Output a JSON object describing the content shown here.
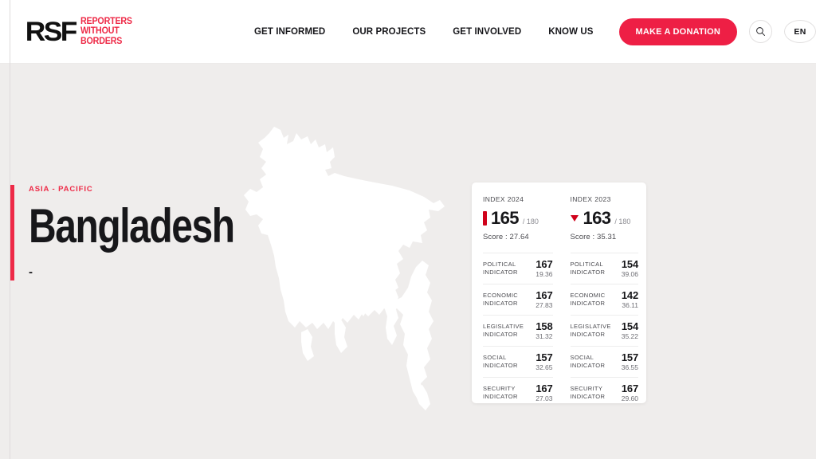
{
  "header": {
    "logo": {
      "mark": "RSF",
      "line1": "REPORTERS",
      "line2": "WITHOUT BORDERS"
    },
    "nav": [
      {
        "label": "GET INFORMED"
      },
      {
        "label": "OUR PROJECTS"
      },
      {
        "label": "GET INVOLVED"
      },
      {
        "label": "KNOW US"
      }
    ],
    "donate_label": "MAKE A DONATION",
    "search_icon": "search-icon",
    "language": "EN",
    "accent_color": "#ee1f45"
  },
  "hero": {
    "region": "ASIA - PACIFIC",
    "country": "Bangladesh",
    "subtitle": "-",
    "accent_color": "#ee2a47",
    "map_name": "bangladesh-map",
    "map_fill": "#ffffff"
  },
  "card": {
    "columns": [
      {
        "title": "INDEX 2024",
        "trend": "stable",
        "rank": "165",
        "total": "/ 180",
        "score_label": "Score : 27.64",
        "indicators": [
          {
            "name": "POLITICAL INDICATOR",
            "rank": "167",
            "score": "19.36"
          },
          {
            "name": "ECONOMIC INDICATOR",
            "rank": "167",
            "score": "27.83"
          },
          {
            "name": "LEGISLATIVE INDICATOR",
            "rank": "158",
            "score": "31.32"
          },
          {
            "name": "SOCIAL INDICATOR",
            "rank": "157",
            "score": "32.65"
          },
          {
            "name": "SECURITY INDICATOR",
            "rank": "167",
            "score": "27.03"
          }
        ]
      },
      {
        "title": "INDEX 2023",
        "trend": "down",
        "rank": "163",
        "total": "/ 180",
        "score_label": "Score : 35.31",
        "indicators": [
          {
            "name": "POLITICAL INDICATOR",
            "rank": "154",
            "score": "39.06"
          },
          {
            "name": "ECONOMIC INDICATOR",
            "rank": "142",
            "score": "36.11"
          },
          {
            "name": "LEGISLATIVE INDICATOR",
            "rank": "154",
            "score": "35.22"
          },
          {
            "name": "SOCIAL INDICATOR",
            "rank": "157",
            "score": "36.55"
          },
          {
            "name": "SECURITY INDICATOR",
            "rank": "167",
            "score": "29.60"
          }
        ]
      }
    ],
    "marker_color": "#d0021b"
  }
}
